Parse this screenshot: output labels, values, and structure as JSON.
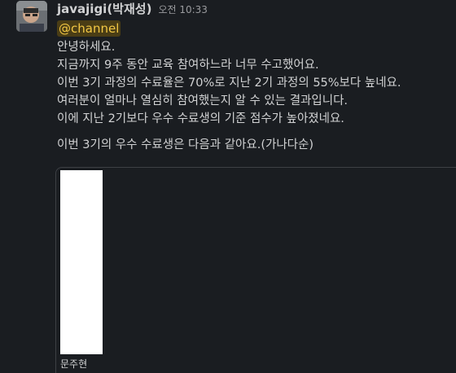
{
  "message": {
    "sender": "javajigi(박재성)",
    "timestamp": "오전 10:33",
    "mention": "@channel",
    "lines": [
      "안녕하세요.",
      "지금까지 9주 동안 교육 참여하느라 너무 수고했어요.",
      "이번 3기 과정의 수료율은 70%로 지난 2기 과정의 55%보다 높네요.",
      "여러분이 얼마나 열심히 참여했는지 알 수 있는 결과입니다.",
      "이에 지난 2기보다 우수 수료생의 기준 점수가 높아졌네요."
    ],
    "intro": "이번 3기의 우수 수료생은 다음과 같아요.(가나다순)"
  },
  "attachment": {
    "caption": "문주현"
  }
}
